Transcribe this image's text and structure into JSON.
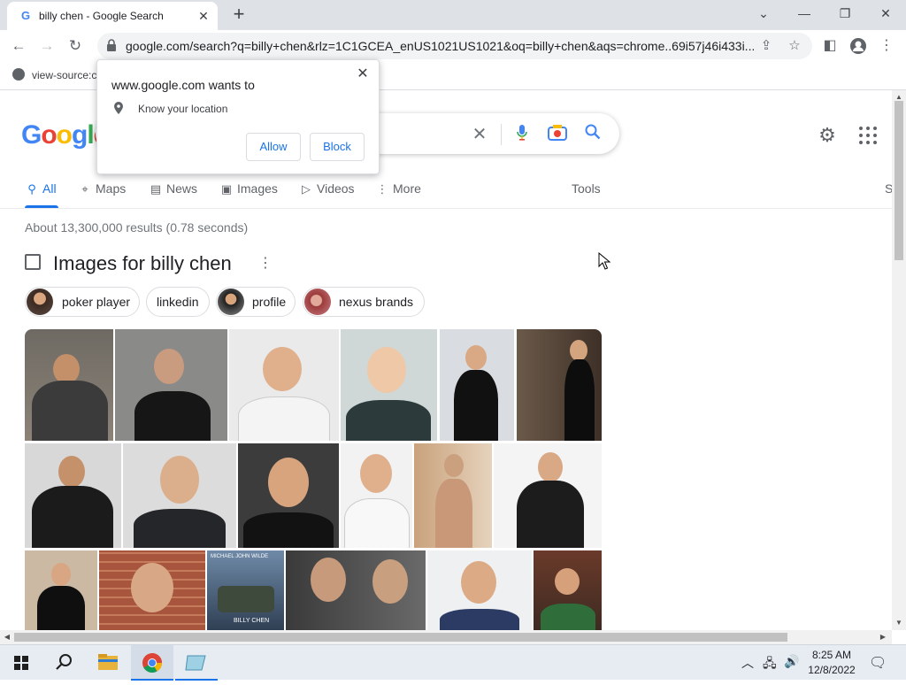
{
  "browser": {
    "tab_title": "billy chen - Google Search",
    "tab_favicon": "G",
    "url": "google.com/search?q=billy+chen&rlz=1C1GCEA_enUS1021US1021&oq=billy+chen&aqs=chrome..69i57j46i433i...",
    "bookmark_label": "view-source:c",
    "icons": [
      "back-icon",
      "forward-icon",
      "reload-icon",
      "lock-icon",
      "share-icon",
      "star-icon",
      "sidepanel-icon",
      "profile-icon",
      "menu-icon"
    ]
  },
  "popup": {
    "title": "www.google.com wants to",
    "message": "Know your location",
    "allow_label": "Allow",
    "block_label": "Block"
  },
  "search": {
    "logo": "Google",
    "nav_tabs": [
      {
        "label": "All",
        "icon": "search-icon",
        "active": true
      },
      {
        "label": "Maps",
        "icon": "map-pin-icon"
      },
      {
        "label": "News",
        "icon": "news-icon"
      },
      {
        "label": "Images",
        "icon": "image-icon"
      },
      {
        "label": "Videos",
        "icon": "video-icon"
      },
      {
        "label": "More",
        "icon": "kebab-icon"
      }
    ],
    "tools_label": "Tools",
    "right_edge_label": "S",
    "result_stats": "About 13,300,000 results (0.78 seconds)",
    "images_heading": "Images for billy chen",
    "chips": [
      {
        "label": "poker player",
        "has_thumb": true
      },
      {
        "label": "linkedin",
        "has_thumb": false
      },
      {
        "label": "profile",
        "has_thumb": true
      },
      {
        "label": "nexus brands",
        "has_thumb": true
      }
    ],
    "image_caption": "MICHAEL JOHN WILDE",
    "image_signature": "BILLY CHEN"
  },
  "taskbar": {
    "time": "8:25 AM",
    "date": "12/8/2022",
    "apps": [
      "windows-start-icon",
      "search-icon",
      "file-explorer-icon",
      "chrome-icon",
      "app-icon"
    ]
  },
  "colors": {
    "accent": "#1a73e8",
    "google_blue": "#4285f4",
    "google_red": "#ea4335",
    "google_yellow": "#fbbc05",
    "google_green": "#34a853"
  }
}
